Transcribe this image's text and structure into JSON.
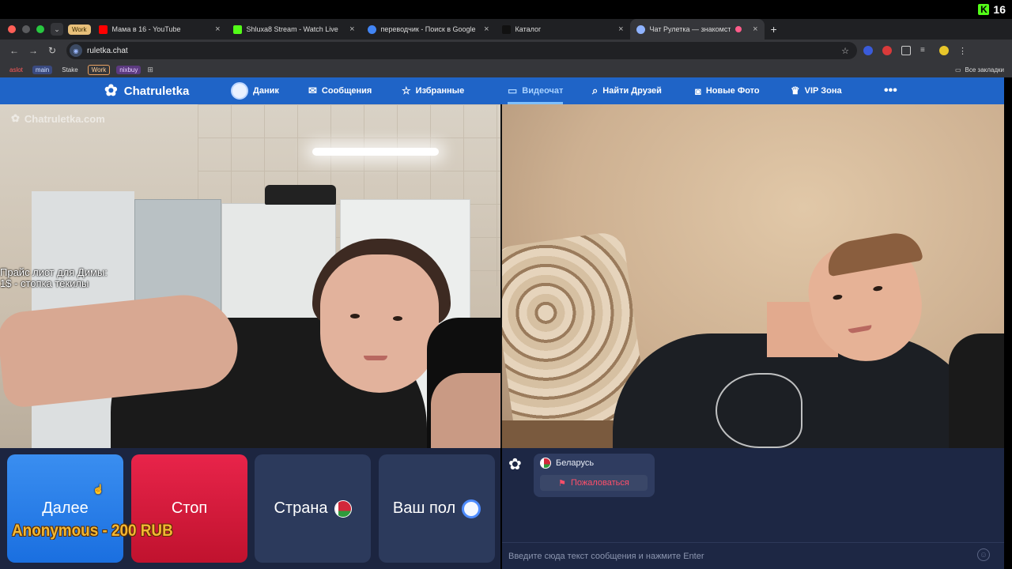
{
  "stream": {
    "viewer_count": "16"
  },
  "browser": {
    "tab_group": "Work",
    "tabs": [
      {
        "title": "Мама в 16 - YouTube",
        "favicon_color": "#ff0000"
      },
      {
        "title": "Shluxa8 Stream - Watch Live",
        "favicon_color": "#53fc18"
      },
      {
        "title": "переводчик - Поиск в Google",
        "favicon_color": "#4285f4"
      },
      {
        "title": "Каталог",
        "favicon_color": "#111111"
      },
      {
        "title": "Чат Рулетка — знакомст",
        "favicon_color": "#8fb3ff",
        "active": true
      }
    ],
    "new_tab": "+",
    "url": "ruletka.chat",
    "bookmarks": [
      "aslot",
      "main",
      "Stake",
      "Work",
      "nixbuy"
    ],
    "all_bookmarks": "Все закладки"
  },
  "site": {
    "brand": "Chatruletka",
    "nav": [
      {
        "label": "Даник",
        "icon": "avatar"
      },
      {
        "label": "Сообщения",
        "icon": "mail-icon"
      },
      {
        "label": "Избранные",
        "icon": "star-icon"
      },
      {
        "label": "Видеочат",
        "icon": "camera-icon",
        "active": true
      },
      {
        "label": "Найти Друзей",
        "icon": "search-icon"
      },
      {
        "label": "Новые Фото",
        "icon": "photo-icon"
      },
      {
        "label": "VIP Зона",
        "icon": "crown-icon"
      }
    ],
    "more": "•••",
    "watermark": "Chatruletka.com",
    "overlay_line1": "Прайс лист для Димы:",
    "overlay_line2": "1$ - стопка текилы"
  },
  "controls": {
    "next": "Далее",
    "stop": "Стоп",
    "country": "Страна",
    "gender": "Ваш пол",
    "donation": "Anonymous - 200 RUB"
  },
  "chat": {
    "partner_country": "Беларусь",
    "report": "Пожаловаться",
    "input_placeholder": "Введите сюда текст сообщения и нажмите Enter"
  },
  "colors": {
    "header_blue": "#1f64c7",
    "next_blue": "#2a7fe8",
    "stop_red": "#d81a3c",
    "panel_navy": "#1d2744",
    "donation_gold": "#f2b733"
  }
}
